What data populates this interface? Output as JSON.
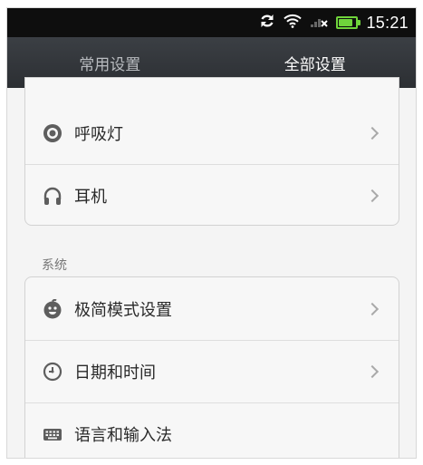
{
  "status_bar": {
    "time": "15:21",
    "battery_level": 0.85,
    "icons": [
      "sync-icon",
      "wifi-icon",
      "signal-icon",
      "battery-icon"
    ]
  },
  "tabs": [
    {
      "label": "常用设置",
      "selected": false
    },
    {
      "label": "全部设置",
      "selected": true
    }
  ],
  "top_group": {
    "items": [
      {
        "label": "呼吸灯",
        "icon": "breathing-light-icon"
      },
      {
        "label": "耳机",
        "icon": "headphones-icon"
      }
    ]
  },
  "system_section": {
    "title": "系统",
    "items": [
      {
        "label": "极简模式设置",
        "icon": "simple-mode-icon"
      },
      {
        "label": "日期和时间",
        "icon": "clock-icon"
      },
      {
        "label": "语言和输入法",
        "icon": "keyboard-icon"
      }
    ]
  },
  "colors": {
    "tab_bar": "#2c2f33",
    "battery": "#6fd43b",
    "background": "#f4f4f4"
  }
}
